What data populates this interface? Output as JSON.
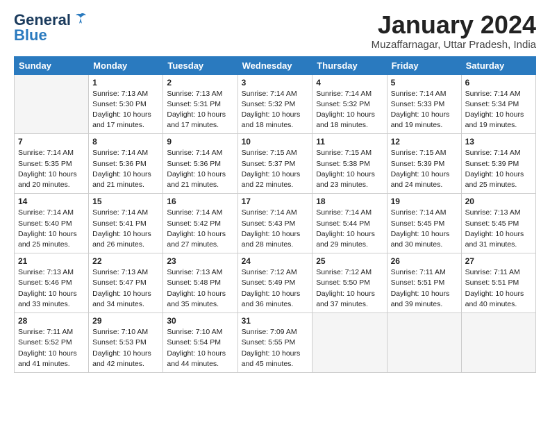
{
  "logo": {
    "line1": "General",
    "line2": "Blue"
  },
  "title": "January 2024",
  "location": "Muzaffarnagar, Uttar Pradesh, India",
  "days_of_week": [
    "Sunday",
    "Monday",
    "Tuesday",
    "Wednesday",
    "Thursday",
    "Friday",
    "Saturday"
  ],
  "weeks": [
    [
      {
        "day": "",
        "info": ""
      },
      {
        "day": "1",
        "info": "Sunrise: 7:13 AM\nSunset: 5:30 PM\nDaylight: 10 hours\nand 17 minutes."
      },
      {
        "day": "2",
        "info": "Sunrise: 7:13 AM\nSunset: 5:31 PM\nDaylight: 10 hours\nand 17 minutes."
      },
      {
        "day": "3",
        "info": "Sunrise: 7:14 AM\nSunset: 5:32 PM\nDaylight: 10 hours\nand 18 minutes."
      },
      {
        "day": "4",
        "info": "Sunrise: 7:14 AM\nSunset: 5:32 PM\nDaylight: 10 hours\nand 18 minutes."
      },
      {
        "day": "5",
        "info": "Sunrise: 7:14 AM\nSunset: 5:33 PM\nDaylight: 10 hours\nand 19 minutes."
      },
      {
        "day": "6",
        "info": "Sunrise: 7:14 AM\nSunset: 5:34 PM\nDaylight: 10 hours\nand 19 minutes."
      }
    ],
    [
      {
        "day": "7",
        "info": "Sunrise: 7:14 AM\nSunset: 5:35 PM\nDaylight: 10 hours\nand 20 minutes."
      },
      {
        "day": "8",
        "info": "Sunrise: 7:14 AM\nSunset: 5:36 PM\nDaylight: 10 hours\nand 21 minutes."
      },
      {
        "day": "9",
        "info": "Sunrise: 7:14 AM\nSunset: 5:36 PM\nDaylight: 10 hours\nand 21 minutes."
      },
      {
        "day": "10",
        "info": "Sunrise: 7:15 AM\nSunset: 5:37 PM\nDaylight: 10 hours\nand 22 minutes."
      },
      {
        "day": "11",
        "info": "Sunrise: 7:15 AM\nSunset: 5:38 PM\nDaylight: 10 hours\nand 23 minutes."
      },
      {
        "day": "12",
        "info": "Sunrise: 7:15 AM\nSunset: 5:39 PM\nDaylight: 10 hours\nand 24 minutes."
      },
      {
        "day": "13",
        "info": "Sunrise: 7:14 AM\nSunset: 5:39 PM\nDaylight: 10 hours\nand 25 minutes."
      }
    ],
    [
      {
        "day": "14",
        "info": "Sunrise: 7:14 AM\nSunset: 5:40 PM\nDaylight: 10 hours\nand 25 minutes."
      },
      {
        "day": "15",
        "info": "Sunrise: 7:14 AM\nSunset: 5:41 PM\nDaylight: 10 hours\nand 26 minutes."
      },
      {
        "day": "16",
        "info": "Sunrise: 7:14 AM\nSunset: 5:42 PM\nDaylight: 10 hours\nand 27 minutes."
      },
      {
        "day": "17",
        "info": "Sunrise: 7:14 AM\nSunset: 5:43 PM\nDaylight: 10 hours\nand 28 minutes."
      },
      {
        "day": "18",
        "info": "Sunrise: 7:14 AM\nSunset: 5:44 PM\nDaylight: 10 hours\nand 29 minutes."
      },
      {
        "day": "19",
        "info": "Sunrise: 7:14 AM\nSunset: 5:45 PM\nDaylight: 10 hours\nand 30 minutes."
      },
      {
        "day": "20",
        "info": "Sunrise: 7:13 AM\nSunset: 5:45 PM\nDaylight: 10 hours\nand 31 minutes."
      }
    ],
    [
      {
        "day": "21",
        "info": "Sunrise: 7:13 AM\nSunset: 5:46 PM\nDaylight: 10 hours\nand 33 minutes."
      },
      {
        "day": "22",
        "info": "Sunrise: 7:13 AM\nSunset: 5:47 PM\nDaylight: 10 hours\nand 34 minutes."
      },
      {
        "day": "23",
        "info": "Sunrise: 7:13 AM\nSunset: 5:48 PM\nDaylight: 10 hours\nand 35 minutes."
      },
      {
        "day": "24",
        "info": "Sunrise: 7:12 AM\nSunset: 5:49 PM\nDaylight: 10 hours\nand 36 minutes."
      },
      {
        "day": "25",
        "info": "Sunrise: 7:12 AM\nSunset: 5:50 PM\nDaylight: 10 hours\nand 37 minutes."
      },
      {
        "day": "26",
        "info": "Sunrise: 7:11 AM\nSunset: 5:51 PM\nDaylight: 10 hours\nand 39 minutes."
      },
      {
        "day": "27",
        "info": "Sunrise: 7:11 AM\nSunset: 5:51 PM\nDaylight: 10 hours\nand 40 minutes."
      }
    ],
    [
      {
        "day": "28",
        "info": "Sunrise: 7:11 AM\nSunset: 5:52 PM\nDaylight: 10 hours\nand 41 minutes."
      },
      {
        "day": "29",
        "info": "Sunrise: 7:10 AM\nSunset: 5:53 PM\nDaylight: 10 hours\nand 42 minutes."
      },
      {
        "day": "30",
        "info": "Sunrise: 7:10 AM\nSunset: 5:54 PM\nDaylight: 10 hours\nand 44 minutes."
      },
      {
        "day": "31",
        "info": "Sunrise: 7:09 AM\nSunset: 5:55 PM\nDaylight: 10 hours\nand 45 minutes."
      },
      {
        "day": "",
        "info": ""
      },
      {
        "day": "",
        "info": ""
      },
      {
        "day": "",
        "info": ""
      }
    ]
  ]
}
